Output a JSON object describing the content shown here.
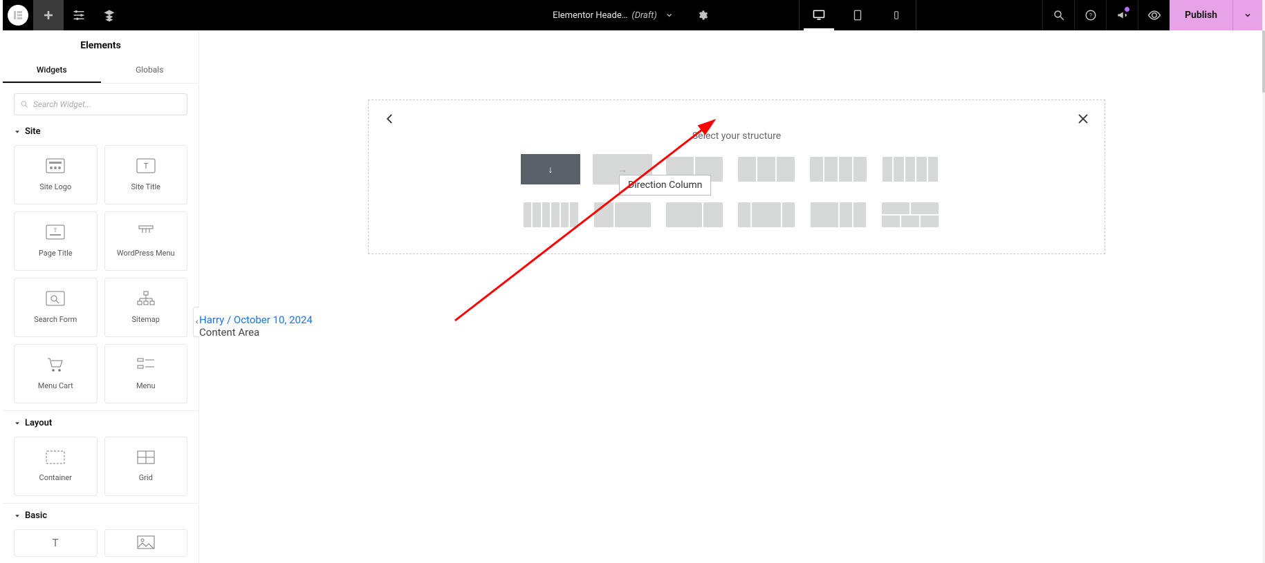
{
  "topbar": {
    "title": "Elementor Heade…",
    "draft": "(Draft)",
    "publish_label": "Publish"
  },
  "panel": {
    "heading": "Elements",
    "tabs": {
      "widgets": "Widgets",
      "globals": "Globals"
    },
    "search_placeholder": "Search Widget...",
    "cat_site": "Site",
    "cat_layout": "Layout",
    "cat_basic": "Basic",
    "site_widgets": [
      "Site Logo",
      "Site Title",
      "Page Title",
      "WordPress Menu",
      "Search Form",
      "Sitemap",
      "Menu Cart",
      "Menu"
    ],
    "layout_widgets": [
      "Container",
      "Grid"
    ]
  },
  "meta": {
    "byline": " Harry / October 10, 2024",
    "content": "Content Area"
  },
  "chooser": {
    "title": "Select your structure",
    "tooltip": "Direction Column"
  }
}
